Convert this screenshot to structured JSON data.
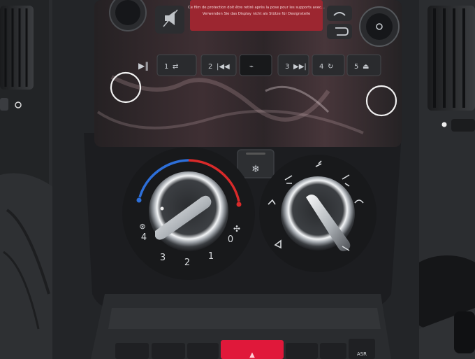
{
  "radio": {
    "screen_text_line1": "Ce film de protection doit être retiré après la pose pour les supports avec...",
    "screen_text_line2": "Verwenden Sie das Display nicht als Stütze für Designsteile",
    "buttons": [
      {
        "label": "1",
        "icon": "shuffle-icon"
      },
      {
        "label": "2",
        "icon": "skip-back-icon"
      },
      {
        "label": "",
        "icon": "usb-port-icon"
      },
      {
        "label": "3",
        "icon": "skip-forward-icon"
      },
      {
        "label": "4",
        "icon": "repeat-icon"
      },
      {
        "label": "5",
        "icon": "disc-eject-icon"
      }
    ]
  },
  "climate": {
    "fan_dial": {
      "levels": [
        "0",
        "1",
        "2",
        "3",
        "4"
      ],
      "icons": [
        "fan-icon",
        "defrost-icon"
      ]
    },
    "ac_button_icon": "snowflake-icon",
    "airflow_icons": [
      "face-vent-icon",
      "face-feet-icon",
      "feet-icon",
      "feet-defrost-icon",
      "defrost-icon",
      "recirculation-icon"
    ],
    "temp_scale_colors": {
      "cold": "#2d6fd9",
      "hot": "#d92a2a"
    }
  },
  "lower_panel": {
    "asr_label": "ASR",
    "hazard_color": "#e0183a"
  },
  "colors": {
    "dashboard": "#26282b",
    "panel": "#1f2123",
    "screen": "#9c2630",
    "chrome": "#c9cdd2"
  }
}
